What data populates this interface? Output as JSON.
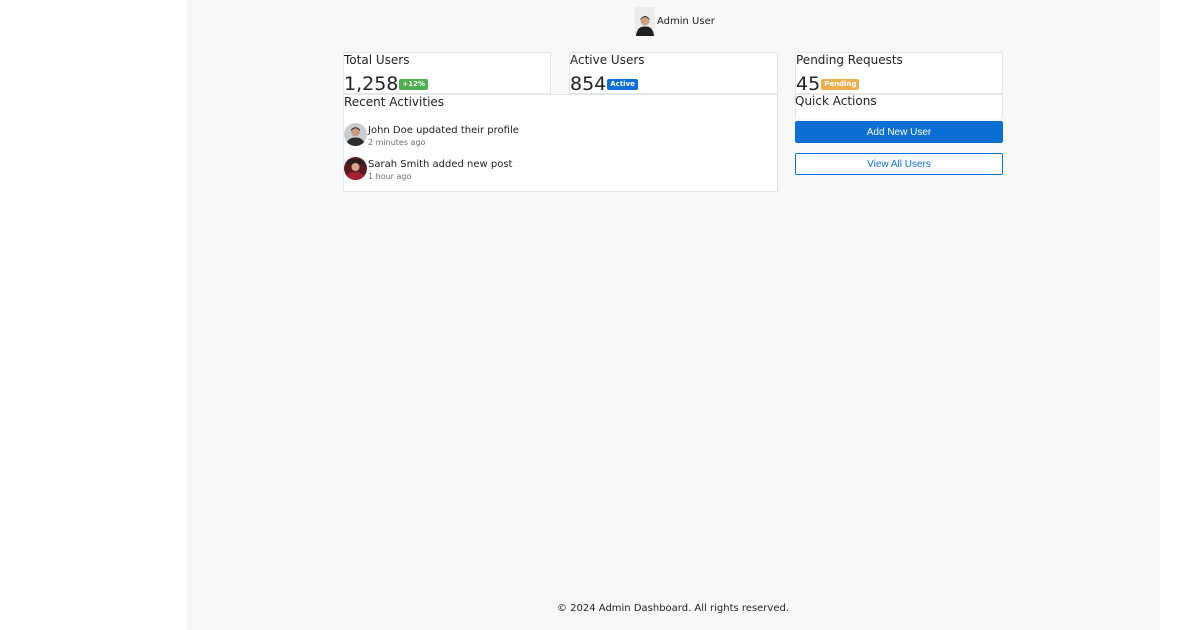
{
  "header": {
    "user_name": "Admin User",
    "avatar_icon": "user-avatar-icon"
  },
  "stats": [
    {
      "title": "Total Users",
      "value": "1,258",
      "badge": "+12%",
      "badge_color": "#4caf50"
    },
    {
      "title": "Active Users",
      "value": "854",
      "badge": "Active",
      "badge_color": "#0a6fd6"
    },
    {
      "title": "Pending Requests",
      "value": "45",
      "badge": "Pending",
      "badge_color": "#f0ad4e"
    }
  ],
  "activities": {
    "title": "Recent Activities",
    "items": [
      {
        "text": "John Doe updated their profile",
        "time": "2 minutes ago"
      },
      {
        "text": "Sarah Smith added new post",
        "time": "1 hour ago"
      }
    ]
  },
  "quick_actions": {
    "title": "Quick Actions",
    "primary_label": "Add New User",
    "secondary_label": "View All Users"
  },
  "footer": {
    "text": "© 2024 Admin Dashboard. All rights reserved."
  },
  "colors": {
    "accent": "#0a6fd6",
    "success": "#4caf50",
    "warning": "#f0ad4e",
    "background": "#f7f8fa"
  }
}
